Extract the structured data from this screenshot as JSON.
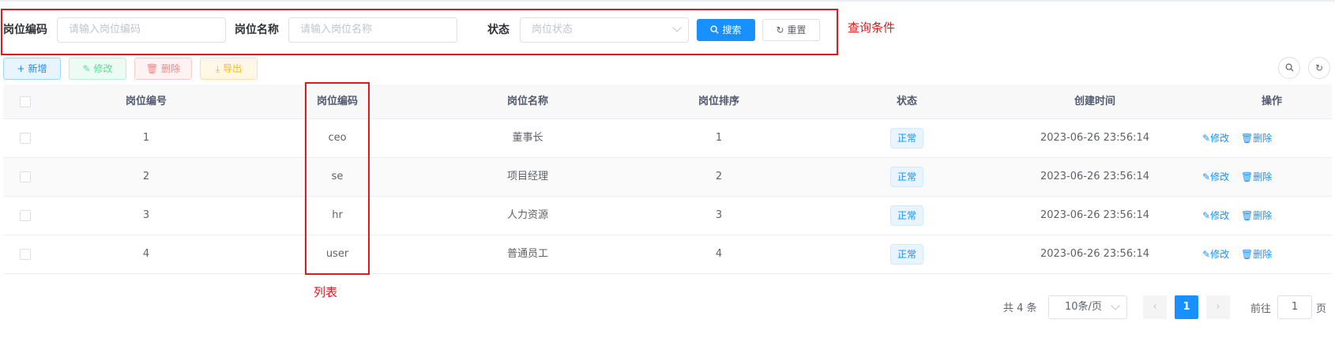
{
  "search": {
    "post_code_label": "岗位编码",
    "post_code_placeholder": "请输入岗位编码",
    "post_name_label": "岗位名称",
    "post_name_placeholder": "请输入岗位名称",
    "status_label": "状态",
    "status_placeholder": "岗位状态",
    "search_button": "搜索",
    "reset_button": "重置"
  },
  "annotations": {
    "query_note": "查询条件",
    "list_note": "列表",
    "color": "#e0191f"
  },
  "toolbar": {
    "add": "新增",
    "edit": "修改",
    "delete": "删除",
    "export": "导出"
  },
  "table": {
    "columns": [
      "岗位编号",
      "岗位编码",
      "岗位名称",
      "岗位排序",
      "状态",
      "创建时间",
      "操作"
    ],
    "rows": [
      {
        "id": "1",
        "code": "ceo",
        "name": "董事长",
        "sort": "1",
        "status": "正常",
        "created": "2023-06-26 23:56:14"
      },
      {
        "id": "2",
        "code": "se",
        "name": "项目经理",
        "sort": "2",
        "status": "正常",
        "created": "2023-06-26 23:56:14"
      },
      {
        "id": "3",
        "code": "hr",
        "name": "人力资源",
        "sort": "3",
        "status": "正常",
        "created": "2023-06-26 23:56:14"
      },
      {
        "id": "4",
        "code": "user",
        "name": "普通员工",
        "sort": "4",
        "status": "正常",
        "created": "2023-06-26 23:56:14"
      }
    ],
    "row_edit": "修改",
    "row_delete": "删除"
  },
  "pagination": {
    "total": "共 4 条",
    "page_size": "10条/页",
    "current_page": "1",
    "goto_label": "前往",
    "goto_value": "1",
    "page_unit": "页"
  },
  "colors": {
    "primary": "#1890ff",
    "success": "#13ce66",
    "danger": "#ff4949",
    "warning": "#ffba00"
  }
}
